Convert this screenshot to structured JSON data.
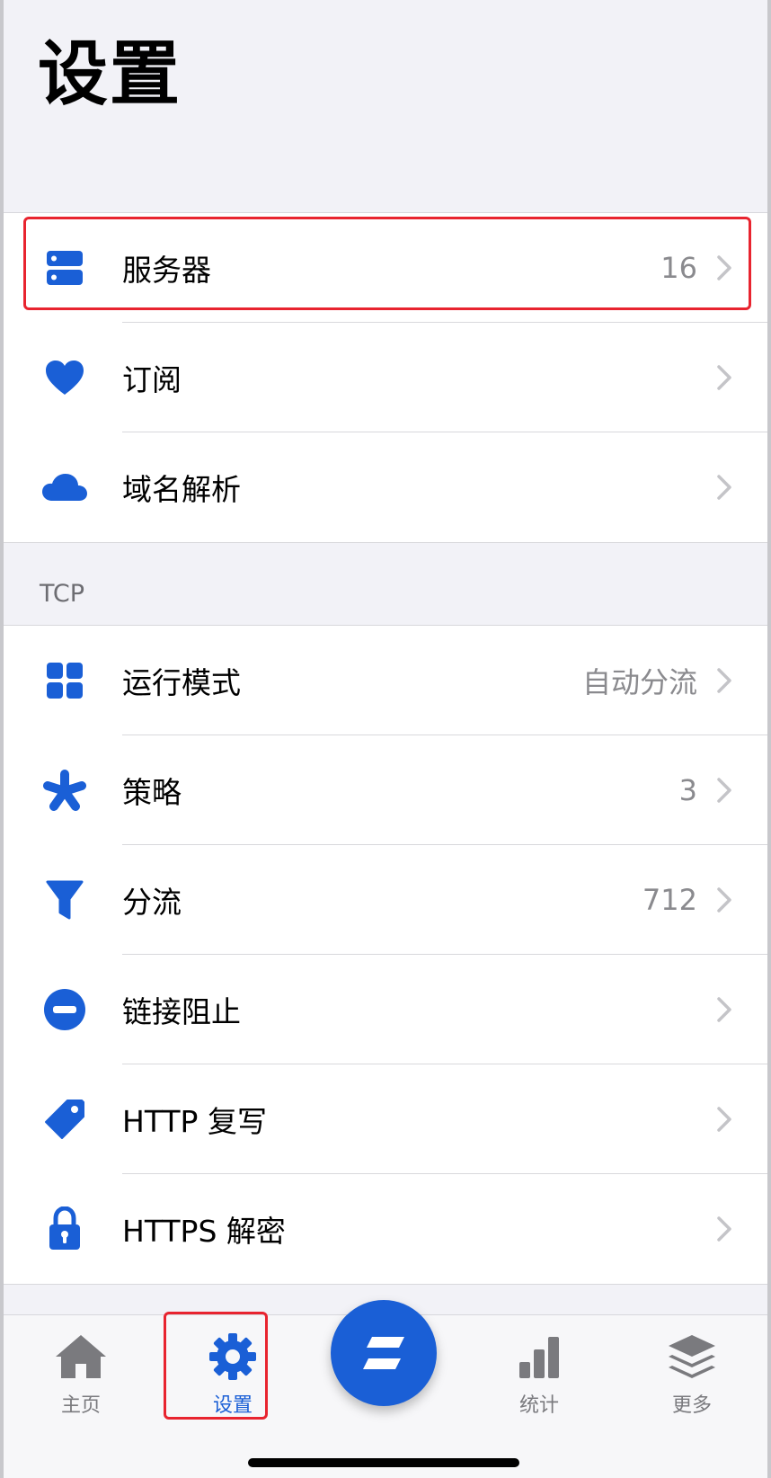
{
  "page": {
    "title": "设置"
  },
  "group1": [
    {
      "label": "服务器",
      "value": "16",
      "icon": "server-icon"
    },
    {
      "label": "订阅",
      "value": "",
      "icon": "heart-icon"
    },
    {
      "label": "域名解析",
      "value": "",
      "icon": "cloud-icon"
    }
  ],
  "section2": {
    "header": "TCP"
  },
  "group2": [
    {
      "label": "运行模式",
      "value": "自动分流",
      "icon": "grid-icon"
    },
    {
      "label": "策略",
      "value": "3",
      "icon": "asterisk-icon"
    },
    {
      "label": "分流",
      "value": "712",
      "icon": "funnel-icon"
    },
    {
      "label": "链接阻止",
      "value": "",
      "icon": "minus-circle-icon"
    },
    {
      "label": "HTTP 复写",
      "value": "",
      "icon": "tag-icon"
    },
    {
      "label": "HTTPS 解密",
      "value": "",
      "icon": "lock-icon"
    }
  ],
  "tabbar": {
    "home": "主页",
    "settings": "设置",
    "stats": "统计",
    "more": "更多"
  },
  "colors": {
    "accent": "#1a5fd6",
    "highlight": "#e8242f"
  }
}
